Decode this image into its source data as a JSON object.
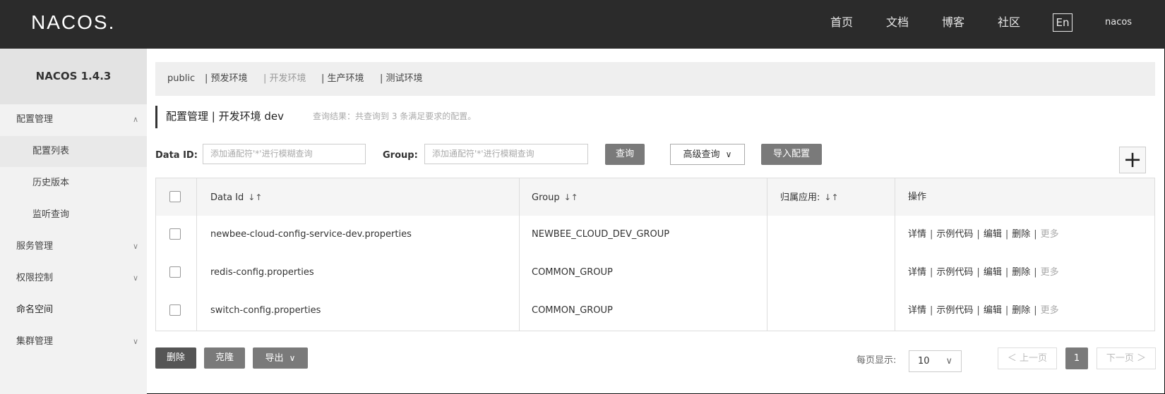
{
  "header": {
    "logo": "NACOS.",
    "nav": [
      "首页",
      "文档",
      "博客",
      "社区"
    ],
    "lang": "En",
    "user": "nacos"
  },
  "sidebar": {
    "version": "NACOS 1.4.3",
    "items": [
      {
        "label": "配置管理",
        "chevron": "∧"
      },
      {
        "label": "配置列表"
      },
      {
        "label": "历史版本"
      },
      {
        "label": "监听查询"
      },
      {
        "label": "服务管理",
        "chevron": "∨"
      },
      {
        "label": "权限控制",
        "chevron": "∨"
      },
      {
        "label": "命名空间"
      },
      {
        "label": "集群管理",
        "chevron": "∨"
      }
    ]
  },
  "namespaces": [
    "public",
    "| 预发环境",
    "| 开发环境",
    "| 生产环境",
    "| 测试环境"
  ],
  "title": {
    "text": "配置管理 | 开发环境  dev",
    "hint": "查询结果：共查询到 3 条满足要求的配置。"
  },
  "search": {
    "data_id_label": "Data ID:",
    "data_id_placeholder": "添加通配符'*'进行模糊查询",
    "group_label": "Group:",
    "group_placeholder": "添加通配符'*'进行模糊查询",
    "query_btn": "查询",
    "advanced_btn": "高级查询",
    "import_btn": "导入配置",
    "add_btn": "+"
  },
  "table": {
    "headers": [
      "Data Id",
      "Group",
      "归属应用:",
      "操作"
    ],
    "sort_icon": "↓↑",
    "rows": [
      {
        "data_id": "newbee-cloud-config-service-dev.properties",
        "group": "NEWBEE_CLOUD_DEV_GROUP",
        "app": ""
      },
      {
        "data_id": "redis-config.properties",
        "group": "COMMON_GROUP",
        "app": ""
      },
      {
        "data_id": "switch-config.properties",
        "group": "COMMON_GROUP",
        "app": ""
      }
    ],
    "ops": [
      "详情",
      "示例代码",
      "编辑",
      "删除",
      "更多"
    ]
  },
  "bottom": {
    "delete_btn": "删除",
    "clone_btn": "克隆",
    "export_btn": "导出",
    "page_size_label": "每页显示:",
    "page_size": "10",
    "prev": "＜ 上一页",
    "current_page": "1",
    "next": "下一页 ＞"
  }
}
